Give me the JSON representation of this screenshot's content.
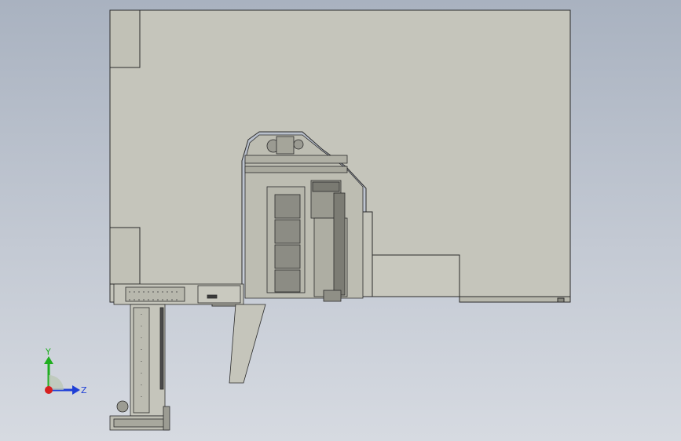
{
  "window": {
    "background_top": "#a9b2c0",
    "background_bottom": "#d6dae1"
  },
  "model": {
    "body_fill": "#c5c5bb",
    "edge_color": "#2b2b2b",
    "detail_fill": "#b8b8ad",
    "dark_detail": "#3a3a3a"
  },
  "triad": {
    "y_label": "Y",
    "z_label": "Z",
    "y_color": "#1fae1f",
    "z_color": "#1f3fd6",
    "x_color": "#d61f1f"
  }
}
